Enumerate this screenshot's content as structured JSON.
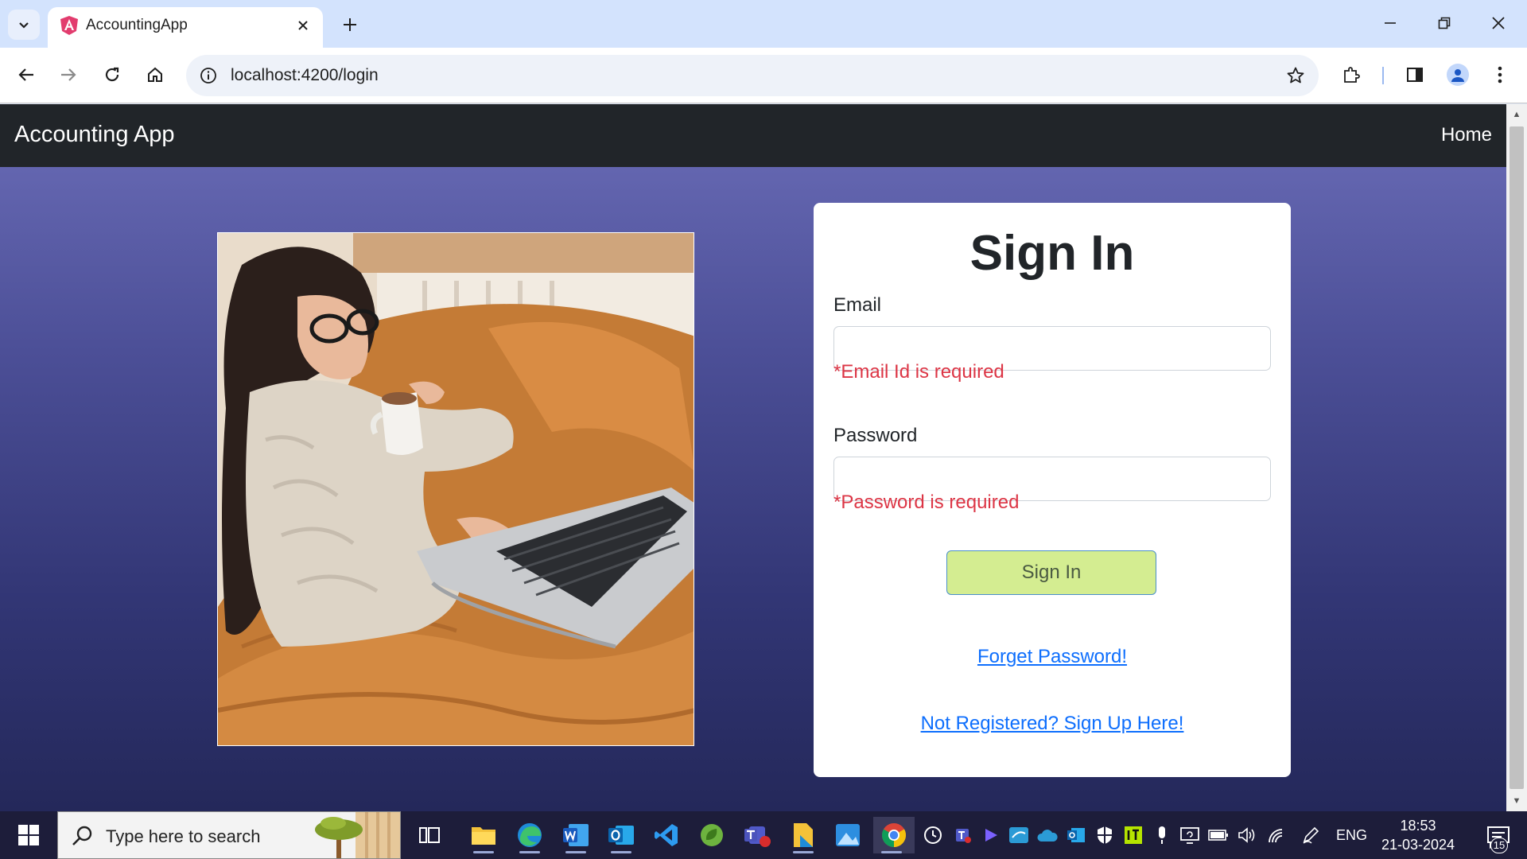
{
  "browser": {
    "tab_title": "AccountingApp",
    "url": "localhost:4200/login"
  },
  "navbar": {
    "brand": "Accounting App",
    "home": "Home"
  },
  "login": {
    "title": "Sign In",
    "email_label": "Email",
    "email_value": "",
    "email_error": "*Email Id is required",
    "password_label": "Password",
    "password_value": "",
    "password_error": "*Password is required",
    "submit_label": "Sign In",
    "forgot_link": "Forget Password!",
    "register_link": "Not Registered? Sign Up Here!"
  },
  "taskbar": {
    "search_placeholder": "Type here to search",
    "language": "ENG",
    "time": "18:53",
    "date": "21-03-2024",
    "notification_count": "15",
    "apps": [
      "task-view",
      "file-explorer",
      "edge",
      "word",
      "outlook",
      "vscode",
      "spring-tool-suite",
      "teams",
      "sticky-files",
      "photos",
      "chrome"
    ]
  },
  "colors": {
    "navbar_bg": "#212529",
    "error": "#dc3545",
    "link": "#0d6efd",
    "signin_button": "#d4ed91",
    "page_gradient_top": "#6b6db8",
    "page_gradient_bottom": "#24285a"
  }
}
